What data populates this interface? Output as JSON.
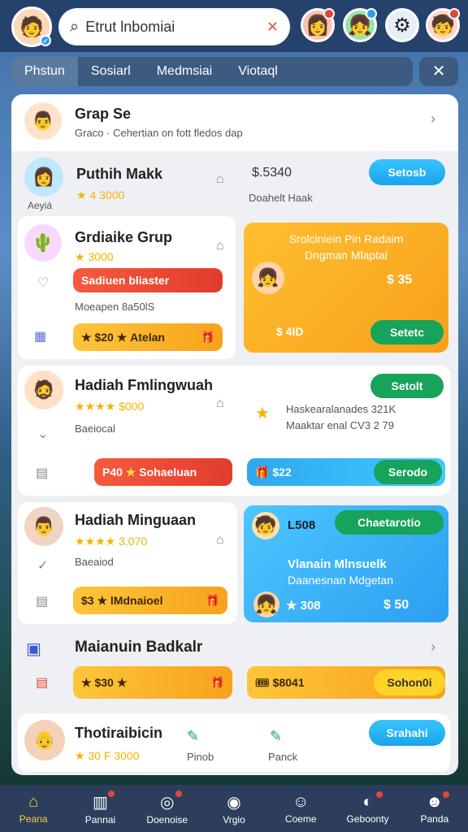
{
  "search": {
    "text": "Etrut lnbomiai"
  },
  "tabs": [
    "Phstun",
    "Sosiarl",
    "Medmsiai",
    "Viotaql"
  ],
  "header_users": [
    {
      "name": "Grap Se",
      "sub": "Graco · Cehertian on fott fledos dap"
    },
    {
      "name": "Puthih Makk",
      "stars_text": "★ 4 3000",
      "label": "Aeyiá",
      "price": "$.5340",
      "price_label": "Doahelt Haak",
      "btn": "Setosb"
    }
  ],
  "gift_groups": [
    {
      "name": "Grdiaike Grup",
      "stars_text": "★ 3000",
      "pill_red": "Sadiuen bliaster",
      "sub": "Moeapen 8a50lS",
      "pill_orange_count": "$20",
      "pill_orange_text": "Atelan",
      "offer": {
        "title": "Srolciniein Pin Radaim",
        "sub": "Dngman Mlaptal",
        "price": "$ 35",
        "price2": "$ 4lD",
        "btn": "Setetc"
      }
    },
    {
      "name": "Hadiah Fmlingwuah",
      "stars_text": "$000",
      "sub": "Baeiocal",
      "btn": "Setolt",
      "note1": "Haskearalanades 321K",
      "note2": "Maaktar enal CV3 2 79",
      "pill_red_count": "P40",
      "pill_red_text": "Sohaeluan",
      "pill_blue_text": "$22",
      "pill_blue_btn": "Serodo"
    },
    {
      "name": "Hadiah Minguaan",
      "stars_text": "3.070",
      "sub": "Baeaiod",
      "pill_orange_count": "$3",
      "pill_orange_text": "lMdnaioel",
      "offer": {
        "count": "L508",
        "btn": "Chaetarotio",
        "title": "Vlanain Mlnsuelk",
        "sub": "Daanesnan Mdgetan",
        "stat": "308",
        "price": "$ 50"
      }
    }
  ],
  "section": {
    "title": "Maianuin Badkalr",
    "pill_orange": "$30",
    "pill_orange2": "$8041",
    "btn_yellow": "Sohon0i"
  },
  "bottom_user": {
    "name": "Thotiraibicin",
    "stars_text": "30 F 3000",
    "action1": "Pinob",
    "action2": "Panck",
    "btn": "Srahahi"
  },
  "nav": [
    "Peana",
    "Pannai",
    "Doenoise",
    "Vrgio",
    "Coeme",
    "Geboonty",
    "Panda"
  ],
  "colors": {
    "accent_green": "#17a35a",
    "accent_blue": "#2aa8f0",
    "accent_orange": "#f7a21b",
    "accent_red": "#e23c2c"
  }
}
